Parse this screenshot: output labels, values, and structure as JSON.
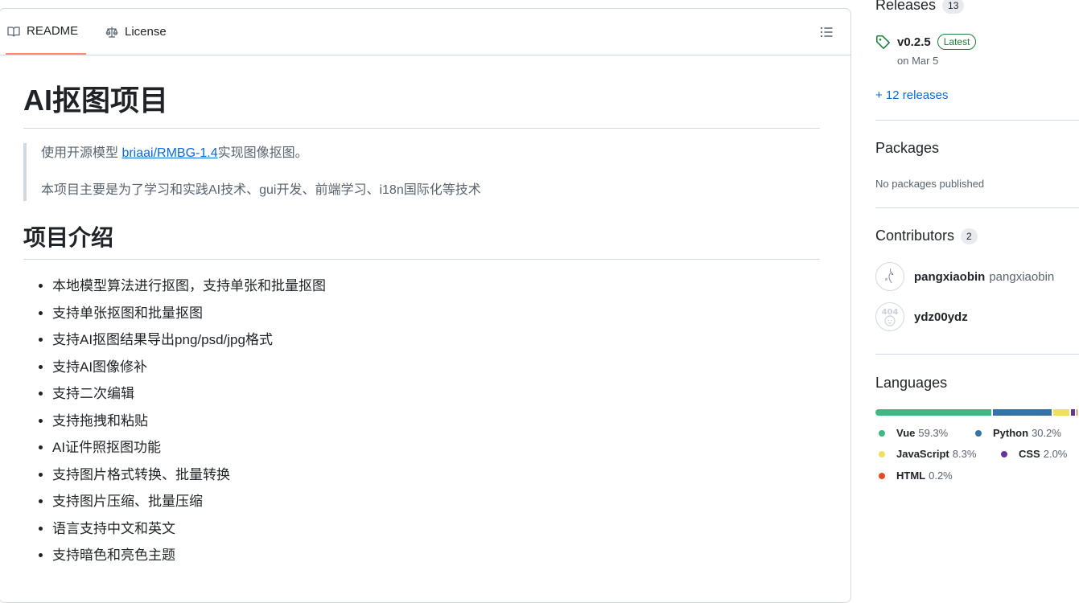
{
  "tabs": {
    "readme": "README",
    "license": "License"
  },
  "readme": {
    "title": "AI抠图项目",
    "quote": {
      "line1_pre": "使用开源模型 ",
      "line1_link": "briaai/RMBG-1.4",
      "line1_post": "实现图像抠图。",
      "line2": "本项目主要是为了学习和实践AI技术、gui开发、前端学习、i18n国际化等技术"
    },
    "section_title": "项目介绍",
    "features": [
      "本地模型算法进行抠图，支持单张和批量抠图",
      "支持单张抠图和批量抠图",
      "支持AI抠图结果导出png/psd/jpg格式",
      "支持AI图像修补",
      "支持二次编辑",
      "支持拖拽和粘贴",
      "AI证件照抠图功能",
      "支持图片格式转换、批量转换",
      "支持图片压缩、批量压缩",
      "语言支持中文和英文",
      "支持暗色和亮色主题"
    ]
  },
  "sidebar": {
    "releases": {
      "title": "Releases",
      "count": "13",
      "latest_version": "v0.2.5",
      "latest_badge": "Latest",
      "date": "on Mar 5",
      "more_link": "+ 12 releases"
    },
    "packages": {
      "title": "Packages",
      "note": "No packages published"
    },
    "contributors": {
      "title": "Contributors",
      "count": "2",
      "items": [
        {
          "login": "pangxiaobin",
          "name": "pangxiaobin"
        },
        {
          "login": "ydz00ydz",
          "name": ""
        }
      ]
    },
    "languages": {
      "title": "Languages",
      "items": [
        {
          "name": "Vue",
          "percent": "59.3%",
          "value": 59.3,
          "color": "#41b883"
        },
        {
          "name": "Python",
          "percent": "30.2%",
          "value": 30.2,
          "color": "#3572a5"
        },
        {
          "name": "JavaScript",
          "percent": "8.3%",
          "value": 8.3,
          "color": "#f1e05a"
        },
        {
          "name": "CSS",
          "percent": "2.0%",
          "value": 2.0,
          "color": "#663399"
        },
        {
          "name": "HTML",
          "percent": "0.2%",
          "value": 0.2,
          "color": "#e34c26"
        }
      ]
    }
  }
}
